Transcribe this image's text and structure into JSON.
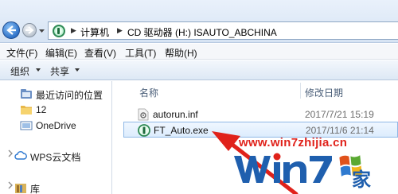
{
  "address_bar": {
    "breadcrumbs": [
      "计算机",
      "CD 驱动器 (H:) ISAUTO_ABCHINA"
    ]
  },
  "menu": {
    "items": [
      "文件(F)",
      "编辑(E)",
      "查看(V)",
      "工具(T)",
      "帮助(H)"
    ]
  },
  "toolbar": {
    "organize_label": "组织",
    "share_label": "共享"
  },
  "nav_pane": {
    "items": [
      {
        "label": "最近访问的位置",
        "icon": "recent-places-icon"
      },
      {
        "label": "12",
        "icon": "folder-icon"
      },
      {
        "label": "OneDrive",
        "icon": "onedrive-icon"
      },
      {
        "label": "WPS云文档",
        "icon": "wps-cloud-icon"
      },
      {
        "label": "库",
        "icon": "library-icon"
      }
    ]
  },
  "file_list": {
    "columns": [
      "名称",
      "修改日期"
    ],
    "rows": [
      {
        "name": "autorun.inf",
        "date": "2017/7/21 15:19",
        "icon": "settings-file-icon",
        "selected": false
      },
      {
        "name": "FT_Auto.exe",
        "date": "2017/11/6 21:14",
        "icon": "green-app-icon",
        "selected": true
      }
    ]
  },
  "watermark": {
    "url": "www.win7zhijia.cn",
    "logo_text": "WIN7",
    "logo_suffix": "家"
  },
  "colors": {
    "arrow": "#e0221b",
    "selection": "#dcecfd",
    "watermark_blue": "#1f5fae"
  }
}
